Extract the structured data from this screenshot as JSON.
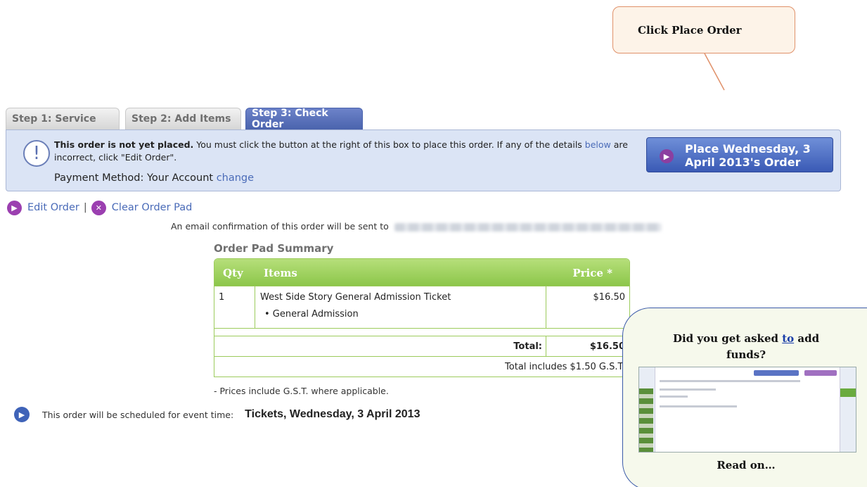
{
  "callout_top": {
    "text": "Click Place Order"
  },
  "tabs": [
    {
      "label": "Step 1: Service"
    },
    {
      "label": "Step 2: Add Items"
    },
    {
      "label": "Step 3: Check Order"
    }
  ],
  "notice": {
    "bold": "This order is not yet placed.",
    "text1": " You must click the button at the right of this box to place this order. If any of the details ",
    "link_below": "below",
    "text2": " are incorrect, click \"Edit Order\".",
    "payment_label": "Payment Method: Your Account ",
    "payment_change": "change",
    "place_button_line1": "Place Wednesday, 3",
    "place_button_line2": "April 2013's Order"
  },
  "actions": {
    "edit": "Edit Order",
    "separator": "|",
    "clear": "Clear Order Pad"
  },
  "email": {
    "text": "An email confirmation of this order will be sent to"
  },
  "summary": {
    "title": "Order Pad Summary",
    "headers": {
      "qty": "Qty",
      "items": "Items",
      "price": "Price *"
    },
    "rows": [
      {
        "qty": "1",
        "item": "West Side Story General Admission Ticket",
        "sub": "• General Admission",
        "price": "$16.50"
      }
    ],
    "total_label": "Total:",
    "total_value": "$16.50",
    "gst_note": "Total includes $1.50 G.S.T."
  },
  "prices_note": "- Prices include G.S.T. where applicable.",
  "schedule": {
    "text": "This order will be scheduled for event time:",
    "value": "Tickets, Wednesday, 3 April 2013"
  },
  "side_callout": {
    "q_part1": "Did you get asked ",
    "q_to": "to",
    "q_part2": " add funds?",
    "read_on": "Read on…"
  }
}
